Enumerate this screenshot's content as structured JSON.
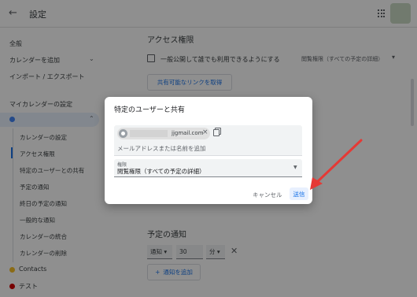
{
  "header": {
    "back_icon": "arrow-left-icon",
    "title": "設定"
  },
  "sidebar": {
    "general": "全般",
    "add_calendar": "カレンダーを追加",
    "import_export": "インポート / エクスポート",
    "my_calendars_heading": "マイカレンダーの設定",
    "calendar_color": "#4285f4",
    "sub_items": [
      "カレンダーの設定",
      "アクセス権限",
      "特定のユーザーとの共有",
      "予定の通知",
      "終日の予定の通知",
      "一般的な通知",
      "カレンダーの統合",
      "カレンダーの削除"
    ],
    "other_calendars": [
      {
        "label": "Contacts",
        "color": "#f6bf26"
      },
      {
        "label": "テスト",
        "color": "#d50000"
      }
    ]
  },
  "main": {
    "access_heading": "アクセス権限",
    "public_checkbox_label": "一般公開して誰でも利用できるようにする",
    "permission_select": "閲覧権限（すべての予定の詳細）",
    "share_link_button": "共有可能なリンクを取得",
    "notif_heading": "予定の通知",
    "notif_type": "通知",
    "notif_amount": "30",
    "notif_unit": "分",
    "add_notification": "通知を追加"
  },
  "dialog": {
    "title": "特定のユーザーと共有",
    "chip_email": "jjgmail.com",
    "chip_close": "×",
    "input_placeholder": "メールアドレスまたは名前を追加",
    "permission_label": "権限",
    "permission_value": "閲覧権限（すべての予定の詳細）",
    "cancel_label": "キャンセル",
    "send_label": "送信"
  },
  "colors": {
    "accent": "#1a73e8",
    "annotation_arrow": "#e53935"
  }
}
